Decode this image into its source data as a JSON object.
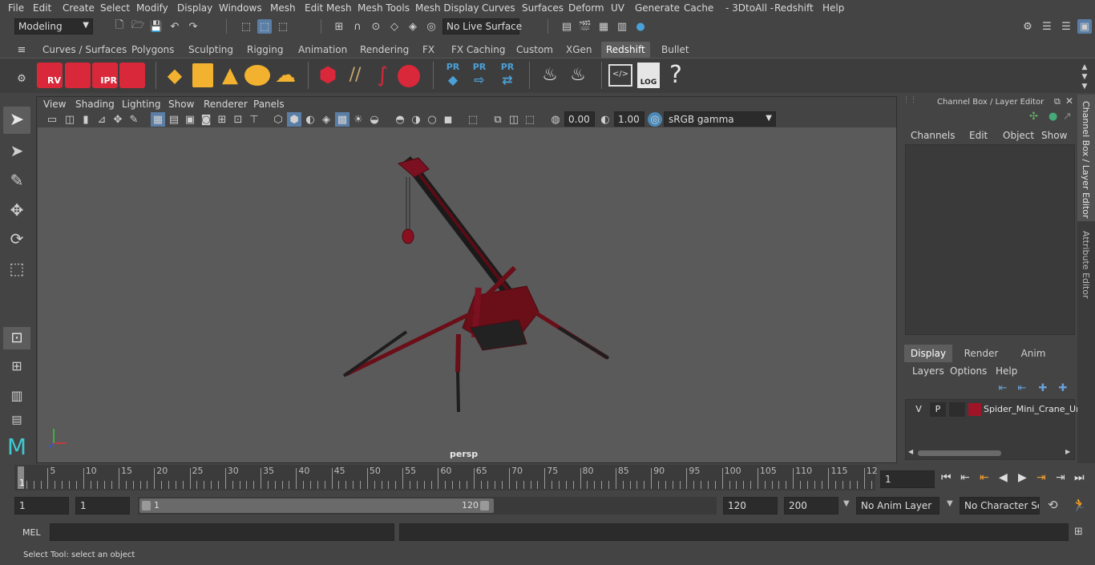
{
  "menubar": [
    "File",
    "Edit",
    "Create",
    "Select",
    "Modify",
    "Display",
    "Windows",
    "Mesh",
    "Edit Mesh",
    "Mesh Tools",
    "Mesh Display",
    "Curves",
    "Surfaces",
    "Deform",
    "UV",
    "Generate",
    "Cache",
    "- 3DtoAll -",
    "Redshift",
    "Help"
  ],
  "status": {
    "mode": "Modeling",
    "live_surface": "No Live Surface"
  },
  "shelf_tabs": [
    "Curves / Surfaces",
    "Polygons",
    "Sculpting",
    "Rigging",
    "Animation",
    "Rendering",
    "FX",
    "FX Caching",
    "Custom",
    "XGen",
    "Redshift",
    "Bullet"
  ],
  "shelf_active": "Redshift",
  "shelf_labels": {
    "rv": "RV",
    "ipr": "IPR",
    "pr1": "PR",
    "pr2": "PR",
    "pr3": "PR",
    "log": "LOG",
    "help": "?"
  },
  "viewport": {
    "menus": [
      "View",
      "Shading",
      "Lighting",
      "Show",
      "Renderer",
      "Panels"
    ],
    "exposure": "0.00",
    "gamma": "1.00",
    "colorspace": "sRGB gamma",
    "camera_label": "persp"
  },
  "channel_box": {
    "title": "Channel Box / Layer Editor",
    "menus": [
      "Channels",
      "Edit",
      "Object",
      "Show"
    ]
  },
  "layer_editor": {
    "tabs": [
      "Display",
      "Render",
      "Anim"
    ],
    "active_tab": "Display",
    "menus": [
      "Layers",
      "Options",
      "Help"
    ],
    "layer": {
      "v": "V",
      "p": "P",
      "name": "Spider_Mini_Crane_Ur",
      "color": "#a01428"
    }
  },
  "side_tabs": [
    "Channel Box / Layer Editor",
    "Attribute Editor"
  ],
  "timeline": {
    "labels": [
      "5",
      "10",
      "15",
      "20",
      "25",
      "30",
      "35",
      "40",
      "45",
      "50",
      "55",
      "60",
      "65",
      "70",
      "75",
      "80",
      "85",
      "90",
      "95",
      "100",
      "105",
      "110",
      "115",
      "12"
    ],
    "start_label": "1",
    "current_frame": "1"
  },
  "range": {
    "start": "1",
    "anim_start": "1",
    "slider_start": "1",
    "slider_end": "120",
    "end": "120",
    "anim_end": "200",
    "anim_layer": "No Anim Layer",
    "character_set": "No Character Set"
  },
  "cmdline": {
    "label": "MEL"
  },
  "help_text": "Select Tool: select an object"
}
